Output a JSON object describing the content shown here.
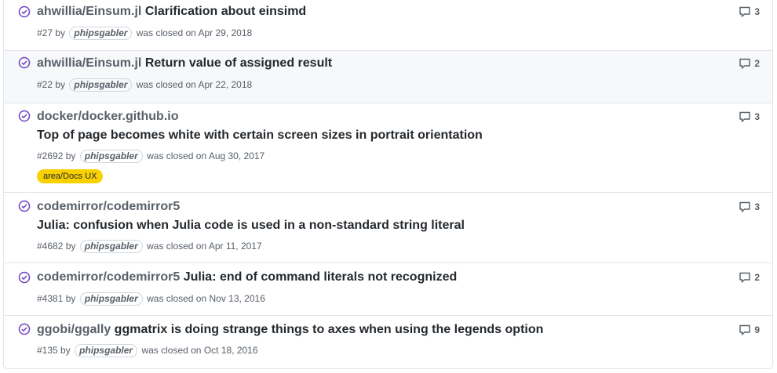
{
  "colors": {
    "closed_icon": "#6f42c1",
    "label_bg": "#f9d000"
  },
  "items": [
    {
      "repo": "ahwillia/Einsum.jl",
      "title": "Clarification about einsimd",
      "number": "#27",
      "by": "by",
      "author": "phipsgabler",
      "closed_text": "was closed on Apr 29, 2018",
      "comments": "3"
    },
    {
      "repo": "ahwillia/Einsum.jl",
      "title": "Return value of assigned result",
      "number": "#22",
      "by": "by",
      "author": "phipsgabler",
      "closed_text": "was closed on Apr 22, 2018",
      "comments": "2"
    },
    {
      "repo": "docker/docker.github.io",
      "title": "Top of page becomes white with certain screen sizes in portrait orientation",
      "number": "#2692",
      "by": "by",
      "author": "phipsgabler",
      "closed_text": "was closed on Aug 30, 2017",
      "comments": "3",
      "label": "area/Docs UX"
    },
    {
      "repo": "codemirror/codemirror5",
      "title": "Julia: confusion when Julia code is used in a non-standard string literal",
      "number": "#4682",
      "by": "by",
      "author": "phipsgabler",
      "closed_text": "was closed on Apr 11, 2017",
      "comments": "3"
    },
    {
      "repo": "codemirror/codemirror5",
      "title": "Julia: end of command literals not recognized",
      "number": "#4381",
      "by": "by",
      "author": "phipsgabler",
      "closed_text": "was closed on Nov 13, 2016",
      "comments": "2"
    },
    {
      "repo": "ggobi/ggally",
      "title": "ggmatrix is doing strange things to axes when using the legends option",
      "number": "#135",
      "by": "by",
      "author": "phipsgabler",
      "closed_text": "was closed on Oct 18, 2016",
      "comments": "9"
    }
  ]
}
